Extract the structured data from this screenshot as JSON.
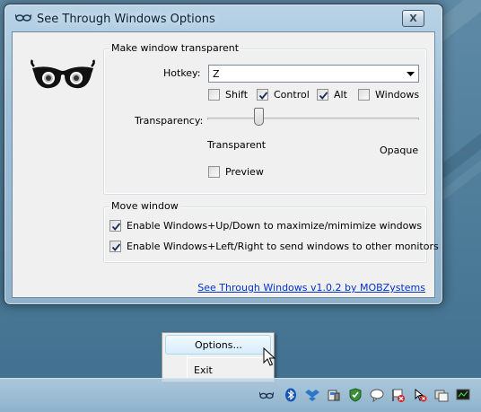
{
  "window": {
    "title": "See Through Windows Options",
    "close_label": "X"
  },
  "make_transparent": {
    "group_title": "Make window transparent",
    "hotkey_label": "Hotkey:",
    "hotkey_value": "Z",
    "modifiers": [
      {
        "label": "Shift",
        "checked": false
      },
      {
        "label": "Control",
        "checked": true
      },
      {
        "label": "Alt",
        "checked": true
      },
      {
        "label": "Windows",
        "checked": false
      }
    ],
    "transparency_label": "Transparency:",
    "transparency_level": 0.24,
    "min_label": "Transparent",
    "max_label": "Opaque",
    "preview_label": "Preview",
    "preview_checked": false
  },
  "move_window": {
    "group_title": "Move window",
    "options": [
      {
        "label": "Enable Windows+Up/Down to maximize/mimimize windows",
        "checked": true
      },
      {
        "label": "Enable Windows+Left/Right to send windows to other monitors",
        "checked": true
      }
    ]
  },
  "about_link": "See Through Windows v1.0.2 by MOBZystems",
  "context_menu": {
    "items": [
      {
        "label": "Options...",
        "highlighted": true
      },
      {
        "label": "Exit",
        "highlighted": false
      }
    ]
  },
  "tray": {
    "icons": [
      "see-through-windows-icon",
      "bluetooth-icon",
      "dropbox-icon",
      "device-icon",
      "shield-icon",
      "chat-bubble-icon",
      "flag-icon",
      "tool-icon",
      "windows-icon",
      "monitor-icon"
    ]
  },
  "colors": {
    "accent_link": "#0033cc",
    "checkmark": "#1c2b5a",
    "menu_highlight": "#d7edfb"
  }
}
